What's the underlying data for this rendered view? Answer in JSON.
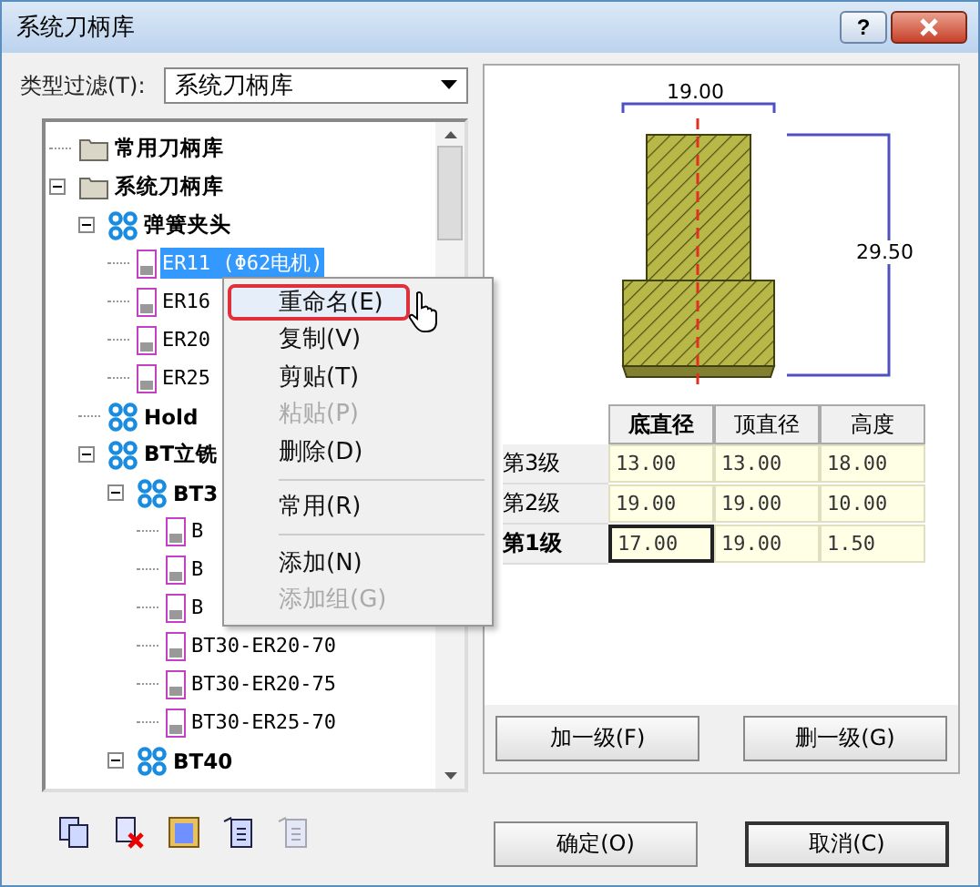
{
  "window": {
    "title": "系统刀柄库",
    "buttons": [
      "?"
    ]
  },
  "filter": {
    "label": "类型过滤(T):",
    "value": "系统刀柄库"
  },
  "tree": [
    {
      "label": "常用刀柄库",
      "kind": "folder",
      "selected": false
    },
    {
      "label": "系统刀柄库",
      "kind": "folder",
      "expanded": true,
      "selected": false,
      "children": [
        {
          "label": "弹簧夹头",
          "kind": "group",
          "expanded": true,
          "selected": false,
          "children": [
            {
              "label": "ER11 (Φ62电机)",
              "kind": "tool",
              "selected": true
            },
            {
              "label": "ER16",
              "kind": "tool",
              "selected": false
            },
            {
              "label": "ER20",
              "kind": "tool",
              "selected": false
            },
            {
              "label": "ER25",
              "kind": "tool",
              "selected": false
            }
          ]
        },
        {
          "label": "Hold",
          "kind": "group",
          "selected": false
        },
        {
          "label": "BT立铣",
          "kind": "group",
          "expanded": true,
          "selected": false,
          "children": [
            {
              "label": "BT3",
              "kind": "group",
              "expanded": true,
              "selected": false,
              "children": [
                {
                  "label": "B",
                  "kind": "tool",
                  "selected": false
                },
                {
                  "label": "B",
                  "kind": "tool",
                  "selected": false
                },
                {
                  "label": "B",
                  "kind": "tool",
                  "selected": false
                },
                {
                  "label": "BT30-ER20-70",
                  "kind": "tool",
                  "selected": false
                },
                {
                  "label": "BT30-ER20-75",
                  "kind": "tool",
                  "selected": false
                },
                {
                  "label": "BT30-ER25-70",
                  "kind": "tool",
                  "selected": false
                }
              ]
            },
            {
              "label": "BT40",
              "kind": "group",
              "expanded": true,
              "selected": false
            }
          ]
        }
      ]
    }
  ],
  "context_menu": [
    {
      "kind": "item",
      "label": "重命名(E)",
      "selected": true,
      "disabled": false
    },
    {
      "kind": "item",
      "label": "复制(V)",
      "selected": false,
      "disabled": false
    },
    {
      "kind": "item",
      "label": "剪贴(T)",
      "selected": false,
      "disabled": false
    },
    {
      "kind": "item",
      "label": "粘贴(P)",
      "selected": false,
      "disabled": true
    },
    {
      "kind": "item",
      "label": "删除(D)",
      "selected": false,
      "disabled": false
    },
    {
      "kind": "separator"
    },
    {
      "kind": "item",
      "label": "常用(R)",
      "selected": false,
      "disabled": false
    },
    {
      "kind": "separator"
    },
    {
      "kind": "item",
      "label": "添加(N)",
      "selected": false,
      "disabled": false
    },
    {
      "kind": "item",
      "label": "添加组(G)",
      "selected": false,
      "disabled": true
    }
  ],
  "toolbar": [
    {
      "kind": "copy",
      "disabled": false
    },
    {
      "kind": "delete",
      "disabled": false
    },
    {
      "kind": "list",
      "disabled": false
    },
    {
      "kind": "paste",
      "disabled": false
    },
    {
      "kind": "paste",
      "disabled": true
    }
  ],
  "preview": {
    "width_label": "19.00",
    "height_label": "29.50"
  },
  "table": {
    "columns": [
      {
        "label": "底直径",
        "selected": true
      },
      {
        "label": "顶直径",
        "selected": false
      },
      {
        "label": "高度",
        "selected": false
      }
    ],
    "rows": [
      {
        "label": "第3级",
        "selected": false,
        "cells": [
          "13.00",
          "13.00",
          "18.00"
        ]
      },
      {
        "label": "第2级",
        "selected": false,
        "cells": [
          "19.00",
          "19.00",
          "10.00"
        ]
      },
      {
        "label": "第1级",
        "selected": true,
        "cells": [
          "17.00",
          "19.00",
          "1.50"
        ]
      }
    ]
  },
  "level_buttons": [
    "加一级(F)",
    "删一级(G)"
  ],
  "buttons": [
    {
      "label": "确定(O)",
      "selected": false
    },
    {
      "label": "取消(C)",
      "selected": true
    }
  ]
}
